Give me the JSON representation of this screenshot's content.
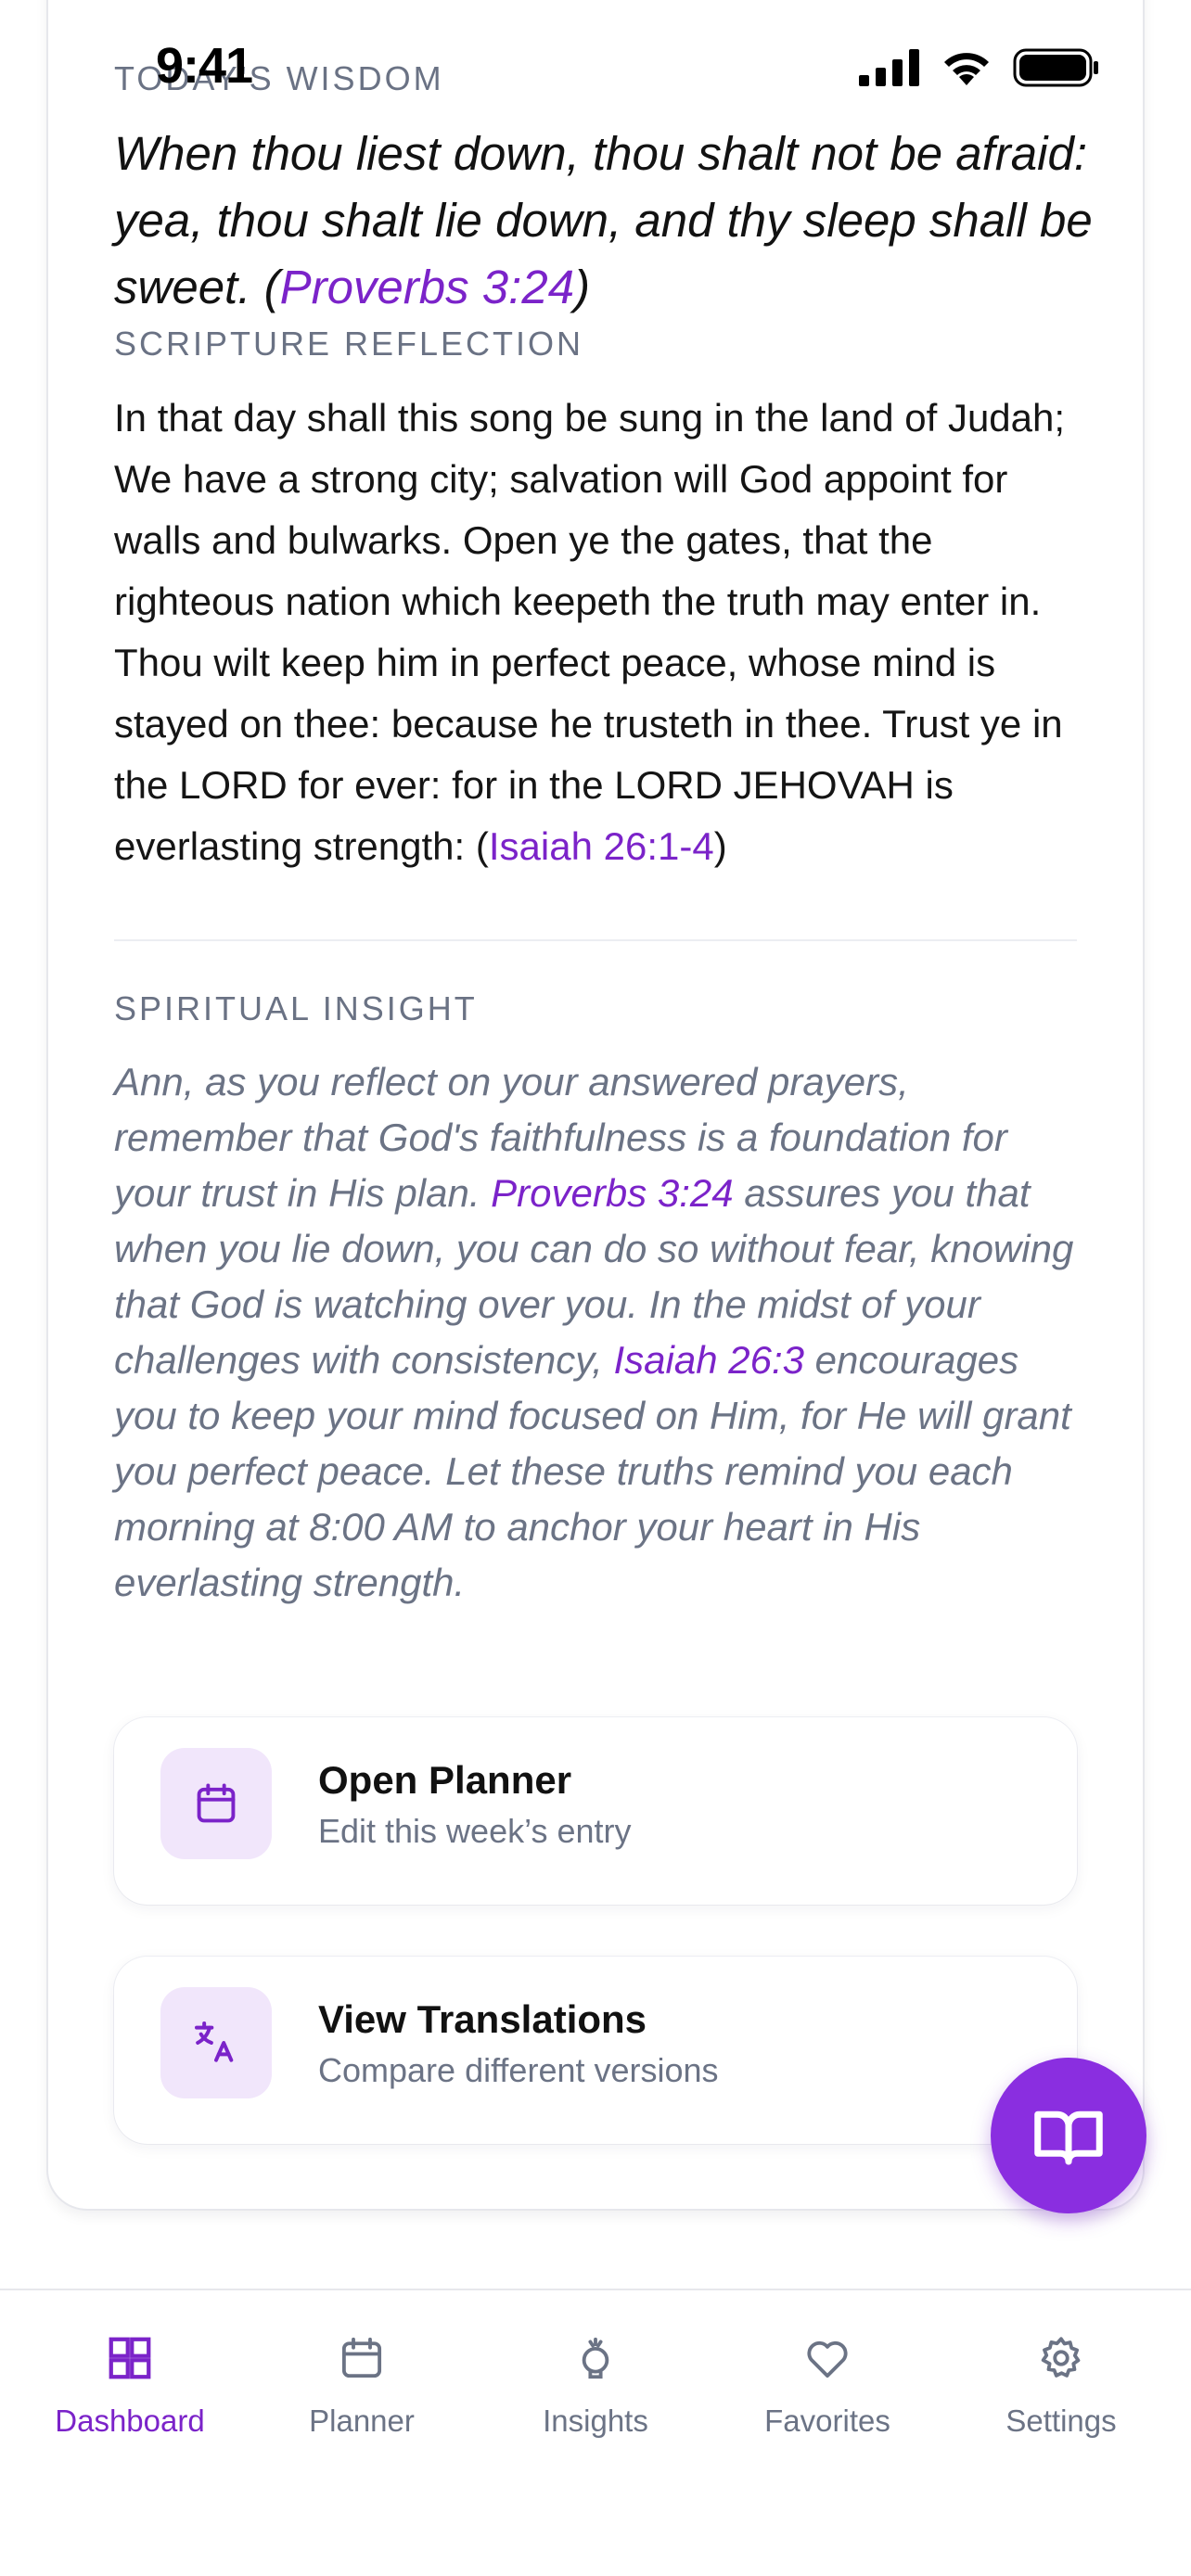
{
  "status_bar": {
    "time": "9:41"
  },
  "wisdom": {
    "label": "TODAY'S WISDOM",
    "quote_text": "When thou liest down, thou shalt not be afraid: yea, thou shalt lie down, and thy sleep shall be sweet. (",
    "quote_ref": "Proverbs 3:24",
    "quote_close": ")"
  },
  "reflection": {
    "label": "SCRIPTURE REFLECTION",
    "text": "In that day shall this song be sung in the land of Judah; We have a strong city; salvation will God appoint for walls and bulwarks. Open ye the gates, that the righteous nation which keepeth the truth may enter in. Thou wilt keep him in perfect peace, whose mind is stayed on thee: because he trusteth in thee. Trust ye in the LORD for ever: for in the LORD JEHOVAH is everlasting strength: (",
    "ref": "Isaiah 26:1-4",
    "close": ")"
  },
  "insight": {
    "label": "SPIRITUAL INSIGHT",
    "part1": "Ann, as you reflect on your answered prayers, remember that God's faithfulness is a foundation for your trust in His plan. ",
    "ref1": "Proverbs 3:24",
    "part2": " assures you that when you lie down, you can do so without fear, knowing that God is watching over you. In the midst of your challenges with consistency, ",
    "ref2": "Isaiah 26:3",
    "part3": " encourages you to keep your mind focused on Him, for He will grant you perfect peace. Let these truths remind you each morning at 8:00 AM to anchor your heart in His everlasting strength."
  },
  "actions": [
    {
      "title": "Open Planner",
      "subtitle": "Edit this week’s entry",
      "icon": "calendar-icon"
    },
    {
      "title": "View Translations",
      "subtitle": "Compare different versions",
      "icon": "translate-icon"
    }
  ],
  "fab": {
    "icon": "book-open-icon"
  },
  "tabbar": {
    "items": [
      {
        "label": "Dashboard",
        "icon": "grid-icon",
        "active": true
      },
      {
        "label": "Planner",
        "icon": "calendar-icon",
        "active": false
      },
      {
        "label": "Insights",
        "icon": "lightbulb-icon",
        "active": false
      },
      {
        "label": "Favorites",
        "icon": "heart-icon",
        "active": false
      },
      {
        "label": "Settings",
        "icon": "gear-icon",
        "active": false
      }
    ]
  },
  "colors": {
    "accent": "#7b23c9",
    "fab": "#8a2ee0",
    "icon_bg": "#f1e6fb",
    "muted": "#6b7385"
  }
}
